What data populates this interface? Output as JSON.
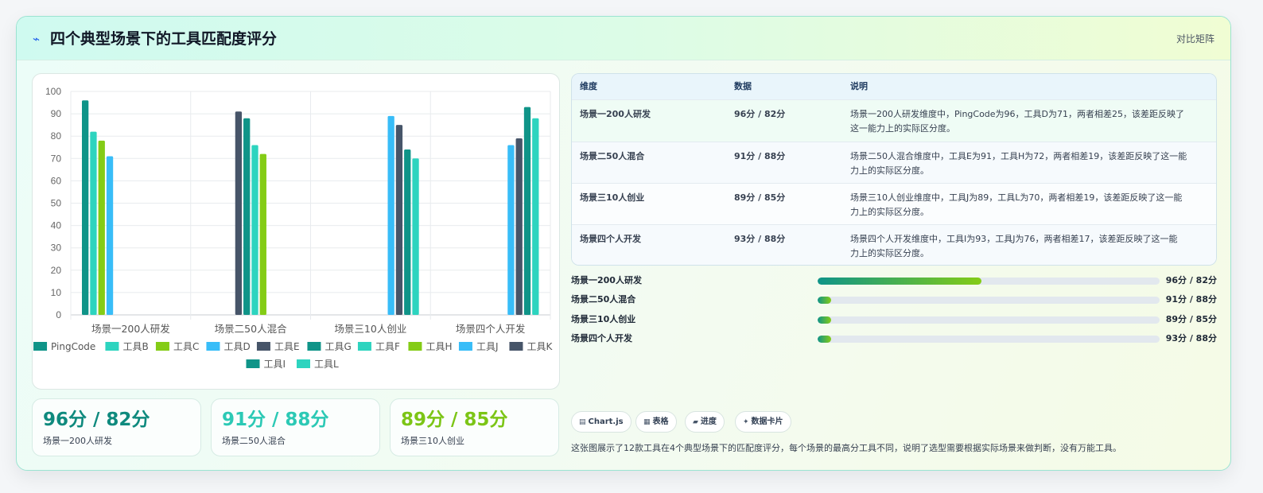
{
  "header": {
    "title": "四个典型场景下的工具匹配度评分",
    "tag": "对比矩阵"
  },
  "chart_data": {
    "type": "bar",
    "categories": [
      "场景一200人研发",
      "场景二50人混合",
      "场景三10人创业",
      "场景四个人开发"
    ],
    "ylim": [
      0,
      100
    ],
    "yticks": [
      0,
      10,
      20,
      30,
      40,
      50,
      60,
      70,
      80,
      90,
      100
    ],
    "grid": true,
    "legend_position": "bottom",
    "series": [
      {
        "name": "PingCode",
        "color": "#0f9488",
        "values": [
          96,
          null,
          null,
          null
        ]
      },
      {
        "name": "工具B",
        "color": "#2dd4bf",
        "values": [
          82,
          null,
          null,
          null
        ]
      },
      {
        "name": "工具C",
        "color": "#84cc16",
        "values": [
          78,
          null,
          null,
          null
        ]
      },
      {
        "name": "工具D",
        "color": "#38bdf8",
        "values": [
          71,
          null,
          null,
          null
        ]
      },
      {
        "name": "工具E",
        "color": "#475569",
        "values": [
          null,
          91,
          null,
          null
        ]
      },
      {
        "name": "工具G",
        "color": "#0f9488",
        "values": [
          null,
          88,
          null,
          null
        ]
      },
      {
        "name": "工具F",
        "color": "#2dd4bf",
        "values": [
          null,
          76,
          null,
          null
        ]
      },
      {
        "name": "工具H",
        "color": "#84cc16",
        "values": [
          null,
          72,
          null,
          null
        ]
      },
      {
        "name": "工具J",
        "color": "#38bdf8",
        "values": [
          null,
          null,
          89,
          76
        ]
      },
      {
        "name": "工具K",
        "color": "#475569",
        "values": [
          null,
          null,
          85,
          79
        ]
      },
      {
        "name": "工具I",
        "color": "#0f9488",
        "values": [
          null,
          null,
          74,
          93
        ]
      },
      {
        "name": "工具L",
        "color": "#2dd4bf",
        "values": [
          null,
          null,
          70,
          88
        ]
      }
    ]
  },
  "stats": [
    {
      "value": "96分 / 82分",
      "label": "场景一200人研发",
      "color": "#0f8a7e"
    },
    {
      "value": "91分 / 88分",
      "label": "场景二50人混合",
      "color": "#2cc9b5"
    },
    {
      "value": "89分 / 85分",
      "label": "场景三10人创业",
      "color": "#7cc516"
    }
  ],
  "table": {
    "headers": [
      "维度",
      "数据",
      "说明"
    ],
    "rows": [
      {
        "dim": "场景一200人研发",
        "data": "96分 / 82分",
        "desc1": "场景一200人研发维度中，PingCode为96，工具D为71，两者相差25，该差距反映了",
        "desc2": "这一能力上的实际区分度。"
      },
      {
        "dim": "场景二50人混合",
        "data": "91分 / 88分",
        "desc1": "场景二50人混合维度中，工具E为91，工具H为72，两者相差19，该差距反映了这一能",
        "desc2": "力上的实际区分度。"
      },
      {
        "dim": "场景三10人创业",
        "data": "89分 / 85分",
        "desc1": "场景三10人创业维度中，工具J为89，工具L为70，两者相差19，该差距反映了这一能",
        "desc2": "力上的实际区分度。"
      },
      {
        "dim": "场景四个人开发",
        "data": "93分 / 88分",
        "desc1": "场景四个人开发维度中，工具I为93，工具J为76，两者相差17，该差距反映了这一能",
        "desc2": "力上的实际区分度。"
      }
    ]
  },
  "progress": [
    {
      "label": "场景一200人研发",
      "value": "96分 / 82分",
      "fill": 0.48
    },
    {
      "label": "场景二50人混合",
      "value": "91分 / 88分",
      "fill": 0.04
    },
    {
      "label": "场景三10人创业",
      "value": "89分 / 85分",
      "fill": 0.04
    },
    {
      "label": "场景四个人开发",
      "value": "93分 / 88分",
      "fill": 0.04
    }
  ],
  "chips": [
    {
      "icon": "chart-icon",
      "label": "Chart.js"
    },
    {
      "icon": "table-icon",
      "label": "表格"
    },
    {
      "icon": "progress-icon",
      "label": "进度"
    },
    {
      "icon": "sparkle-icon",
      "label": "数据卡片"
    }
  ],
  "description": "这张图展示了12款工具在4个典型场景下的匹配度评分，每个场景的最高分工具不同，说明了选型需要根据实际场景来做判断，没有万能工具。"
}
